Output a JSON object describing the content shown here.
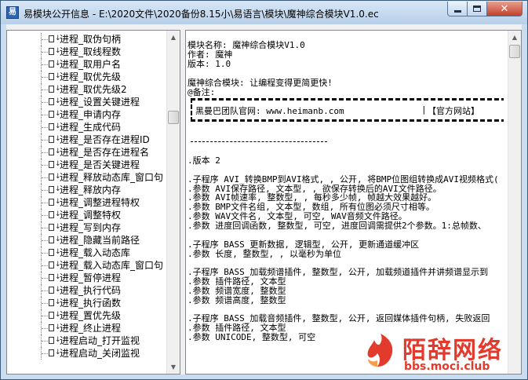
{
  "window": {
    "title": "易模块公开信息 - E:\\2020文件\\2020备份8.15小\\易语言\\模块\\魔神综合模块V1.0.ec",
    "close_label": "✕"
  },
  "tree": {
    "items": [
      {
        "label": "进程_取伪句柄"
      },
      {
        "label": "进程_取线程数"
      },
      {
        "label": "进程_取用户名"
      },
      {
        "label": "进程_取优先级"
      },
      {
        "label": "进程_取优先级2"
      },
      {
        "label": "进程_设置关键进程"
      },
      {
        "label": "进程_申请内存"
      },
      {
        "label": "进程_生成代码"
      },
      {
        "label": "进程_是否存在进程ID"
      },
      {
        "label": "进程_是否存在进程名"
      },
      {
        "label": "进程_是否关键进程"
      },
      {
        "label": "进程_释放动态库_窗口句"
      },
      {
        "label": "进程_释放内存"
      },
      {
        "label": "进程_调整进程特权"
      },
      {
        "label": "进程_调整特权"
      },
      {
        "label": "进程_写到内存"
      },
      {
        "label": "进程_隐藏当前路径"
      },
      {
        "label": "进程_载入动态库"
      },
      {
        "label": "进程_载入动态库_窗口句"
      },
      {
        "label": "进程_暂停进程"
      },
      {
        "label": "进程_执行代码"
      },
      {
        "label": "进程_执行函数"
      },
      {
        "label": "进程_置优先级"
      },
      {
        "label": "进程_终止进程"
      },
      {
        "label": "进程启动_打开监视"
      },
      {
        "label": "进程启动_关闭监视"
      }
    ]
  },
  "doc": {
    "lines": [
      "模块名称: 魔神综合模块V1.0",
      "作者: 魔神",
      "版本: 1.0",
      "",
      "魔神综合模块: 让编程变得更简更快!",
      "@备注:"
    ],
    "banner_text": "黑曼巴团队官网: www.heimanb.com",
    "banner_sep": "|",
    "banner_link": "【官方网站】",
    "body_lines": [
      ".版本 2",
      "",
      ".子程序 AVI_转换BMP到AVI格式, , 公开, 将BMP位图组转换成AVI视频格式(",
      ".参数 AVI保存路径, 文本型, , 欲保存转换后的AVI文件路径。",
      ".参数 AVI帧速率, 整数型, , 每秒多少帧, 帧越大效果越好。",
      ".参数 BMP文件名组, 文本型, 数组, 所有位图必须尺寸相等。",
      ".参数 WAV文件名, 文本型, 可空, WAV音频文件路径。",
      ".参数 进度回调函数, 整数型, 可空, 进度回调需提供2个参数。1:总帧数、",
      "",
      ".子程序 BASS_更新数据, 逻辑型, 公开, 更新通道缓冲区",
      ".参数 长度, 整数型, , 以毫秒为单位",
      "",
      ".子程序 BASS_加载频谱插件, 整数型, 公开, 加载频道插件并讲频谱显示到",
      ".参数 插件路径, 文本型",
      ".参数 频谱宽度, 整数型",
      ".参数 频谱高度, 整数型",
      "",
      ".子程序 BASS_加载音频插件, 整数型, 公开, 返回媒体插件句柄, 失败返回",
      ".参数 插件路径, 文本型",
      ".参数 UNICODE, 整数型, 可空"
    ]
  },
  "watermark": {
    "title": "陌辞网络",
    "url": "bbs.moci.club"
  }
}
